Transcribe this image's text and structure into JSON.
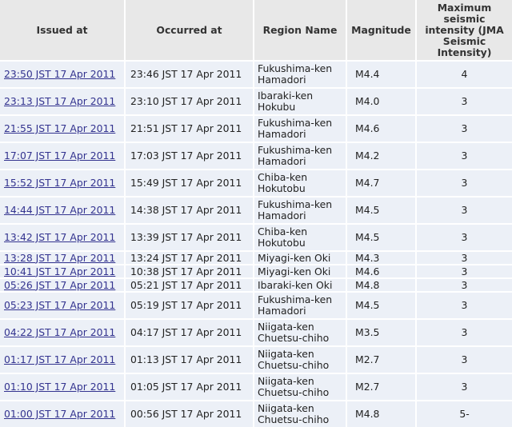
{
  "table": {
    "headers": {
      "issued": "Issued at",
      "occurred": "Occurred at",
      "region": "Region Name",
      "magnitude": "Magnitude",
      "intensity": "Maximum seismic intensity (JMA Seismic Intensity)"
    },
    "rows": [
      {
        "issued": "23:50 JST 17 Apr 2011",
        "occurred": "23:46 JST 17 Apr 2011",
        "region": "Fukushima-ken Hamadori",
        "magnitude": "M4.4",
        "intensity": "4"
      },
      {
        "issued": "23:13 JST 17 Apr 2011",
        "occurred": "23:10 JST 17 Apr 2011",
        "region": "Ibaraki-ken Hokubu",
        "magnitude": "M4.0",
        "intensity": "3"
      },
      {
        "issued": "21:55 JST 17 Apr 2011",
        "occurred": "21:51 JST 17 Apr 2011",
        "region": "Fukushima-ken Hamadori",
        "magnitude": "M4.6",
        "intensity": "3"
      },
      {
        "issued": "17:07 JST 17 Apr 2011",
        "occurred": "17:03 JST 17 Apr 2011",
        "region": "Fukushima-ken Hamadori",
        "magnitude": "M4.2",
        "intensity": "3"
      },
      {
        "issued": "15:52 JST 17 Apr 2011",
        "occurred": "15:49 JST 17 Apr 2011",
        "region": "Chiba-ken Hokutobu",
        "magnitude": "M4.7",
        "intensity": "3"
      },
      {
        "issued": "14:44 JST 17 Apr 2011",
        "occurred": "14:38 JST 17 Apr 2011",
        "region": "Fukushima-ken Hamadori",
        "magnitude": "M4.5",
        "intensity": "3"
      },
      {
        "issued": "13:42 JST 17 Apr 2011",
        "occurred": "13:39 JST 17 Apr 2011",
        "region": "Chiba-ken Hokutobu",
        "magnitude": "M4.5",
        "intensity": "3"
      },
      {
        "issued": "13:28 JST 17 Apr 2011",
        "occurred": "13:24 JST 17 Apr 2011",
        "region": "Miyagi-ken Oki",
        "magnitude": "M4.3",
        "intensity": "3"
      },
      {
        "issued": "10:41 JST 17 Apr 2011",
        "occurred": "10:38 JST 17 Apr 2011",
        "region": "Miyagi-ken Oki",
        "magnitude": "M4.6",
        "intensity": "3"
      },
      {
        "issued": "05:26 JST 17 Apr 2011",
        "occurred": "05:21 JST 17 Apr 2011",
        "region": "Ibaraki-ken Oki",
        "magnitude": "M4.8",
        "intensity": "3"
      },
      {
        "issued": "05:23 JST 17 Apr 2011",
        "occurred": "05:19 JST 17 Apr 2011",
        "region": "Fukushima-ken Hamadori",
        "magnitude": "M4.5",
        "intensity": "3"
      },
      {
        "issued": "04:22 JST 17 Apr 2011",
        "occurred": "04:17 JST 17 Apr 2011",
        "region": "Niigata-ken Chuetsu-chiho",
        "magnitude": "M3.5",
        "intensity": "3"
      },
      {
        "issued": "01:17 JST 17 Apr 2011",
        "occurred": "01:13 JST 17 Apr 2011",
        "region": "Niigata-ken Chuetsu-chiho",
        "magnitude": "M2.7",
        "intensity": "3"
      },
      {
        "issued": "01:10 JST 17 Apr 2011",
        "occurred": "01:05 JST 17 Apr 2011",
        "region": "Niigata-ken Chuetsu-chiho",
        "magnitude": "M2.7",
        "intensity": "3"
      },
      {
        "issued": "01:00 JST 17 Apr 2011",
        "occurred": "00:56 JST 17 Apr 2011",
        "region": "Niigata-ken Chuetsu-chiho",
        "magnitude": "M4.8",
        "intensity": "5-"
      }
    ]
  },
  "colors": {
    "header_bg": "#e8e8e8",
    "row_bg": "#ecf0f7",
    "link": "#33338f"
  }
}
